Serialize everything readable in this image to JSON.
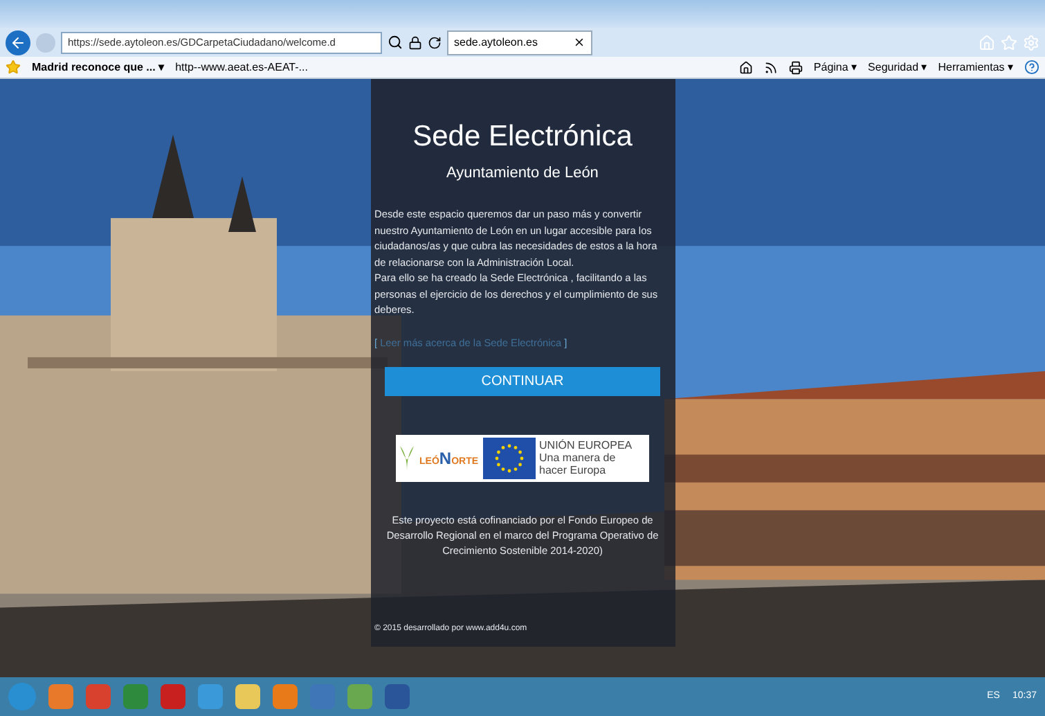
{
  "browser": {
    "url": "https://sede.aytoleon.es/GDCarpetaCiudadano/welcome.d",
    "tabs": [
      {
        "label": "sede.aytoleon.es",
        "selected": true
      }
    ],
    "favorites": [
      {
        "label": "Madrid reconoce que ... ▾"
      },
      {
        "label": "http--www.aeat.es-AEAT-..."
      }
    ],
    "commands": [
      "Página ▾",
      "Seguridad ▾",
      "Herramientas ▾"
    ]
  },
  "page": {
    "kind": "picture",
    "panel": {
      "title": "Sede Electrónica",
      "subtitle": "Ayuntamiento de León",
      "paragraphs": [
        "Desde este espacio queremos dar un paso más y convertir nuestro Ayuntamiento de León en un lugar accesible para los ciudadanos/as y que cubra las necesidades de estos a la hora de relacionarse con la Administración Local.",
        "Para ello se ha creado la Sede Electrónica , facilitando a las personas el ejercicio de los derechos y el cumplimiento de sus deberes."
      ],
      "link": {
        "open": "[",
        "label": "Leer más acerca de la Sede Electrónica",
        "close": "]"
      },
      "button": "CONTINUAR",
      "logos": {
        "leon_a": "LEÓ",
        "leon_b": "N",
        "leon_c": "ORTE",
        "eu": [
          "UNIÓN EUROPEA",
          "Una manera de",
          "hacer Europa"
        ]
      },
      "funding": "Este proyecto está cofinanciado por el Fondo Europeo de Desarrollo Regional en el marco del Programa Operativo de Crecimiento Sostenible 2014-2020)",
      "footer": "© 2015 desarrollado por www.add4u.com"
    }
  },
  "taskbar": {
    "apps": [
      {
        "color": "#e8792b"
      },
      {
        "color": "#d9412f"
      },
      {
        "color": "#2e8b3e"
      },
      {
        "color": "#c8201e"
      },
      {
        "color": "#3a9ad9"
      },
      {
        "color": "#e9c85a"
      },
      {
        "color": "#e87a1a"
      },
      {
        "color": "#3f76b8"
      },
      {
        "color": "#6aa84f"
      },
      {
        "color": "#2a5699"
      }
    ],
    "language": "ES",
    "time": "10:37"
  }
}
